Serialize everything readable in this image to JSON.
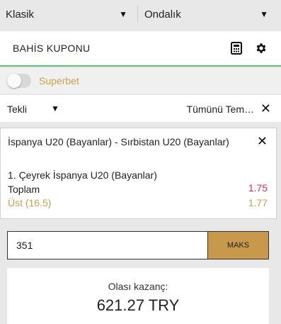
{
  "settings": {
    "odds_type": "Klasik",
    "odds_format": "Ondalık"
  },
  "header": {
    "title": "BAHİS KUPONU",
    "icons": [
      "calculator-icon",
      "gear-icon"
    ]
  },
  "superbet": {
    "label": "Superbet",
    "enabled": false
  },
  "bet_type": {
    "selected": "Tekli",
    "clear_all_label": "Tümünü Tem…"
  },
  "bet": {
    "match": "İspanya U20 (Bayanlar) - Sırbistan U20 (Bayanlar)",
    "market_line1": "1. Çeyrek İspanya U20 (Bayanlar)",
    "market_line2": "Toplam",
    "selection": "Üst (16.5)",
    "previous_odds": "1.75",
    "current_odds": "1.77"
  },
  "stake": {
    "value": "351",
    "max_label": "MAKS"
  },
  "payout": {
    "label": "Olası kazanç:",
    "value": "621.27 TRY"
  },
  "colors": {
    "accent_gold": "#c8a24b",
    "max_button": "#c8994a",
    "odds_red": "#d0304a",
    "header_border_green": "#5ec27a"
  }
}
